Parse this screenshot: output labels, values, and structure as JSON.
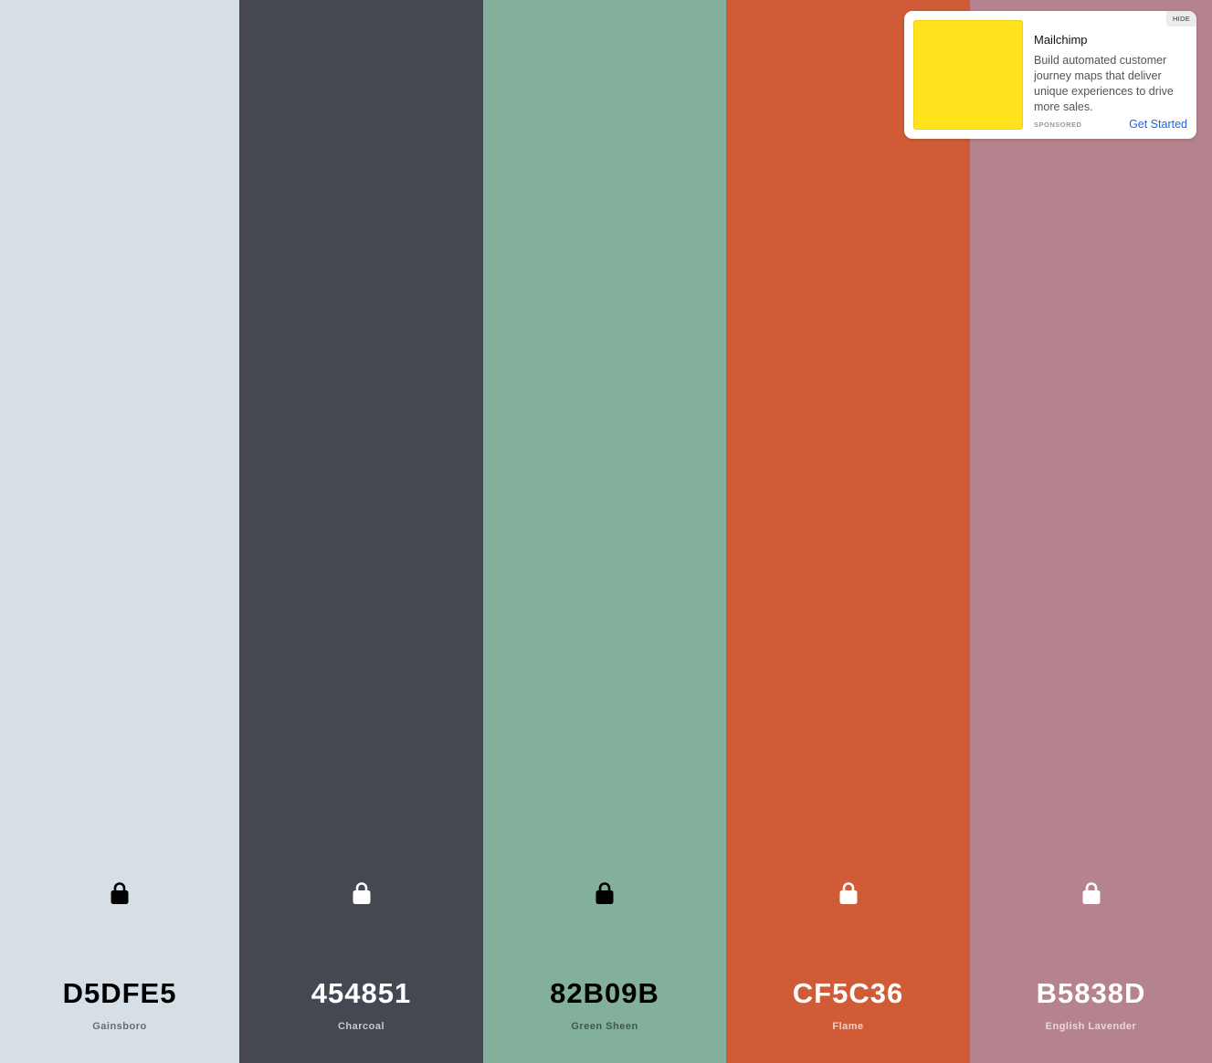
{
  "palette": {
    "colors": [
      {
        "hex": "D5DFE5",
        "name": "Gainsboro",
        "bg": "#D5DFE5",
        "text_color": "#000000",
        "name_color": "#666d72",
        "lock_color": "#000000",
        "lock_icon": "lock-icon"
      },
      {
        "hex": "454851",
        "name": "Charcoal",
        "bg": "#454851",
        "text_color": "#ffffff",
        "name_color": "#c7c8cb",
        "lock_color": "#ffffff",
        "lock_icon": "lock-icon"
      },
      {
        "hex": "82B09B",
        "name": "Green Sheen",
        "bg": "#82B09B",
        "text_color": "#000000",
        "name_color": "#3f5a4d",
        "lock_color": "#000000",
        "lock_icon": "lock-icon"
      },
      {
        "hex": "CF5C36",
        "name": "Flame",
        "bg": "#CF5C36",
        "text_color": "#ffffff",
        "name_color": "#f2cfc3",
        "lock_color": "#ffffff",
        "lock_icon": "lock-icon"
      },
      {
        "hex": "B5838D",
        "name": "English Lavender",
        "bg": "#B5838D",
        "text_color": "#ffffff",
        "name_color": "#ead7db",
        "lock_color": "#ffffff",
        "lock_icon": "lock-icon"
      }
    ]
  },
  "ad": {
    "title": "Mailchimp",
    "body": "Build automated customer journey maps that deliver unique experiences to drive more sales.",
    "sponsored_label": "SPONSORED",
    "cta_label": "Get Started",
    "hide_label": "HIDE",
    "image_color": "#FFE11C",
    "cta_color": "#1A66E8"
  }
}
